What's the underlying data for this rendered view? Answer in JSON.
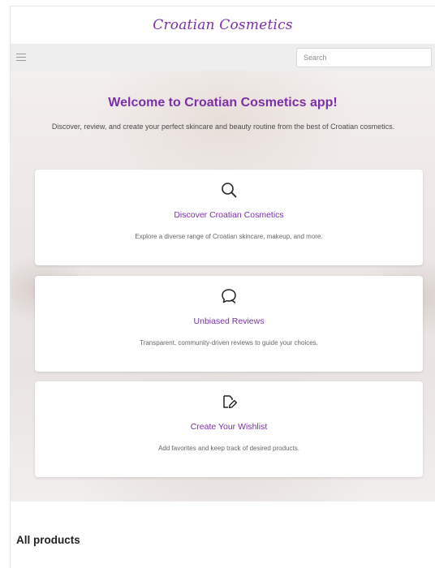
{
  "brand": {
    "name": "Croatian Cosmetics"
  },
  "navbar": {
    "search_placeholder": "Search",
    "menu_icon": "hamburger-menu-icon"
  },
  "hero": {
    "title": "Welcome to Croatian Cosmetics app!",
    "subtitle": "Discover, review, and create your perfect skincare and beauty routine from the best of Croatian cosmetics."
  },
  "features": [
    {
      "icon": "search-icon",
      "title": "Discover Croatian Cosmetics",
      "description": "Explore a diverse range of Croatian skincare, makeup, and more."
    },
    {
      "icon": "chat-bubble-icon",
      "title": "Unbiased Reviews",
      "description": "Transparent, community-driven reviews to guide your choices."
    },
    {
      "icon": "note-edit-icon",
      "title": "Create Your Wishlist",
      "description": "Add favorites and keep track of desired products."
    }
  ],
  "products": {
    "section_title": "All products"
  },
  "colors": {
    "accent": "#7b2fa8",
    "navbar_bg": "#eeeeee"
  }
}
